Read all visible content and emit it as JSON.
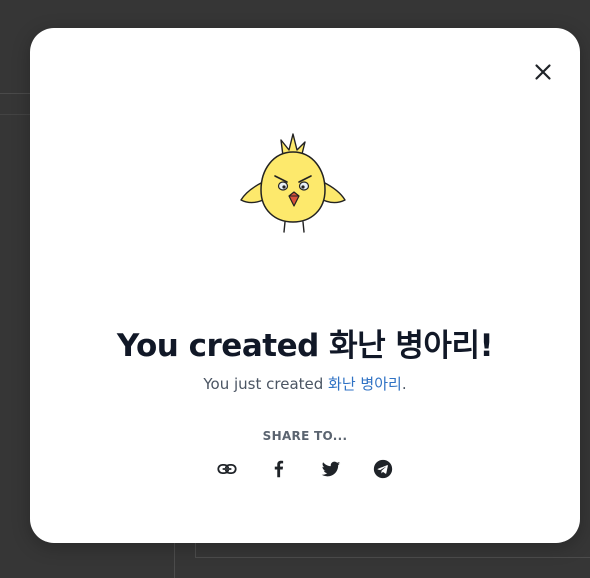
{
  "modal": {
    "title": "You created 화난 병아리!",
    "subtitle_prefix": "You just created ",
    "subtitle_link": "화난 병아리",
    "subtitle_suffix": ".",
    "share_label": "SHARE TO..."
  },
  "icons": {
    "close": "close-icon",
    "mascot": "angry-chick-drawing",
    "share": [
      "link-icon",
      "facebook-icon",
      "twitter-icon",
      "telegram-icon"
    ]
  },
  "colors": {
    "modal_bg": "#ffffff",
    "backdrop": "#363636",
    "title": "#111827",
    "link": "#2f72c4",
    "chick_fill": "#fde96c"
  }
}
